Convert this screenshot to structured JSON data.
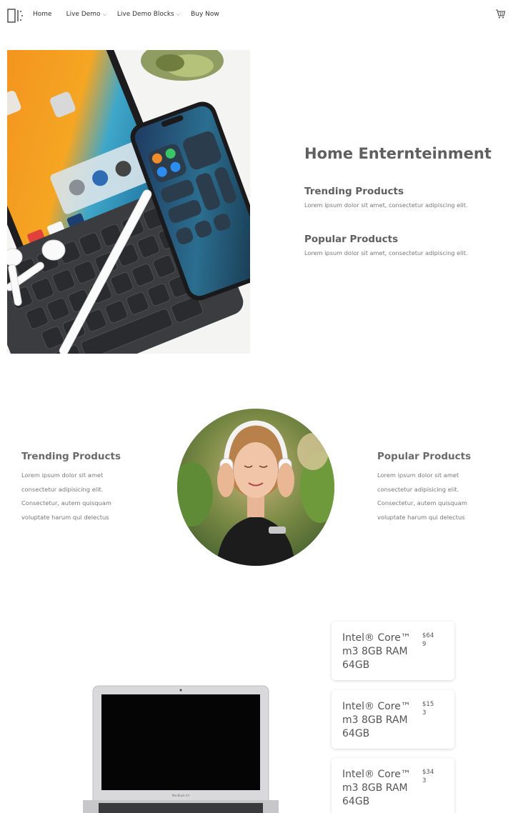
{
  "nav": {
    "items": [
      {
        "label": "Home"
      },
      {
        "label": "Live Demo"
      },
      {
        "label": "Live Demo Blocks"
      },
      {
        "label": "Buy Now"
      }
    ]
  },
  "hero": {
    "title": "Home Enternteinment",
    "features": [
      {
        "title": "Trending Products",
        "text": "Lorem ipsum dolor sit amet, consectetur adipiscing elit."
      },
      {
        "title": "Popular Products",
        "text": "Lorem ipsum dolor sit amet, consectetur adipiscing elit."
      }
    ]
  },
  "showcase": {
    "left": {
      "title": "Trending Products",
      "lines": [
        "Lorem ipsum dolor sit amet",
        "consectetur adipisicing elit.",
        "Consectetur, autem quisquam",
        "voluptate harum qui delectus"
      ]
    },
    "right": {
      "title": "Popular Products",
      "lines": [
        "Lorem ipsum dolor sit amet",
        "consectetur adipisicing elit.",
        "Consectetur, autem quisquam",
        "voluptate harum qui delectus"
      ]
    }
  },
  "products": [
    {
      "name": "Intel® Core™ m3 8GB RAM 64GB",
      "price": "$649"
    },
    {
      "name": "Intel® Core™ m3 8GB RAM 64GB",
      "price": "$153"
    },
    {
      "name": "Intel® Core™ m3 8GB RAM 64GB",
      "price": "$343"
    }
  ],
  "laptop_label": "MacBook Air"
}
